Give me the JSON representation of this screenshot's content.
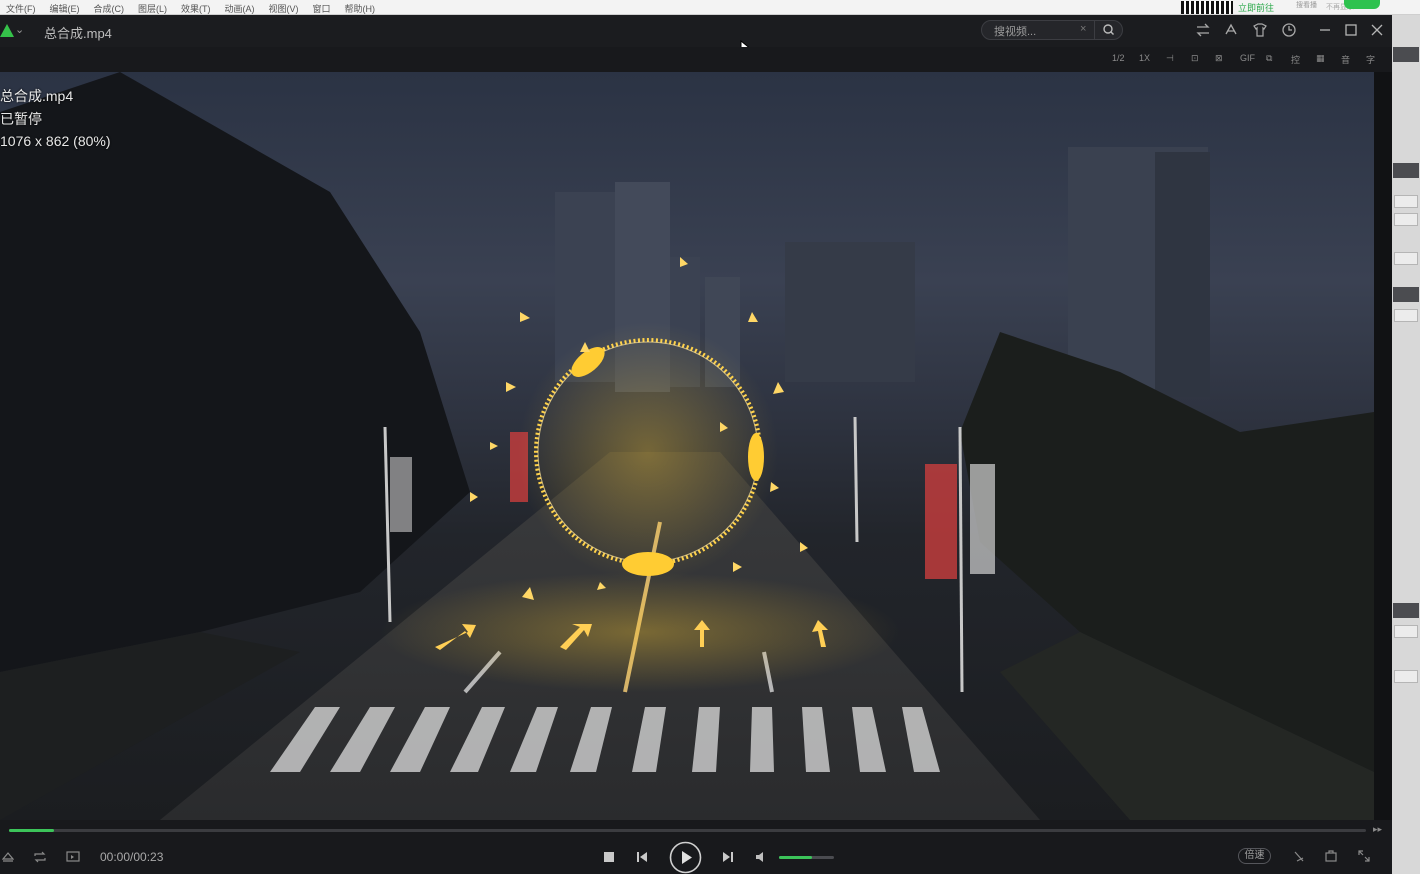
{
  "background_app": {
    "menu": [
      "文件(F)",
      "编辑(E)",
      "合成(C)",
      "图层(L)",
      "效果(T)",
      "动画(A)",
      "视图(V)",
      "窗口",
      "帮助(H)"
    ],
    "promo_text": "立即前往",
    "promo_small": "搜看播",
    "promo_small2": "不再显示"
  },
  "player": {
    "title": "总合成.mp4",
    "search_placeholder": "搜视频...",
    "toolbar": [
      "1/2",
      "1X",
      "⊣",
      "⊡",
      "⊠",
      "⊡",
      "GIF",
      "⧉",
      "控",
      "▦",
      "音",
      "字"
    ],
    "osd": {
      "line1": "总合成.mp4",
      "line2": "已暂停",
      "line3": "1076 x 862 (80%)"
    },
    "time": "00:00/00:23",
    "progress_fraction": 0.033,
    "volume_fraction": 0.6,
    "speed_label": "倍速"
  },
  "icons": {
    "titlebar": [
      "swap-icon",
      "skin-icon",
      "shirt-icon",
      "history-icon",
      "minimize-icon",
      "maximize-icon",
      "close-icon"
    ],
    "controls": [
      "stop-icon",
      "previous-icon",
      "play-icon",
      "next-icon",
      "volume-icon"
    ]
  },
  "colors": {
    "accent": "#3cc45a",
    "ring_glow": "#ffc21a"
  }
}
